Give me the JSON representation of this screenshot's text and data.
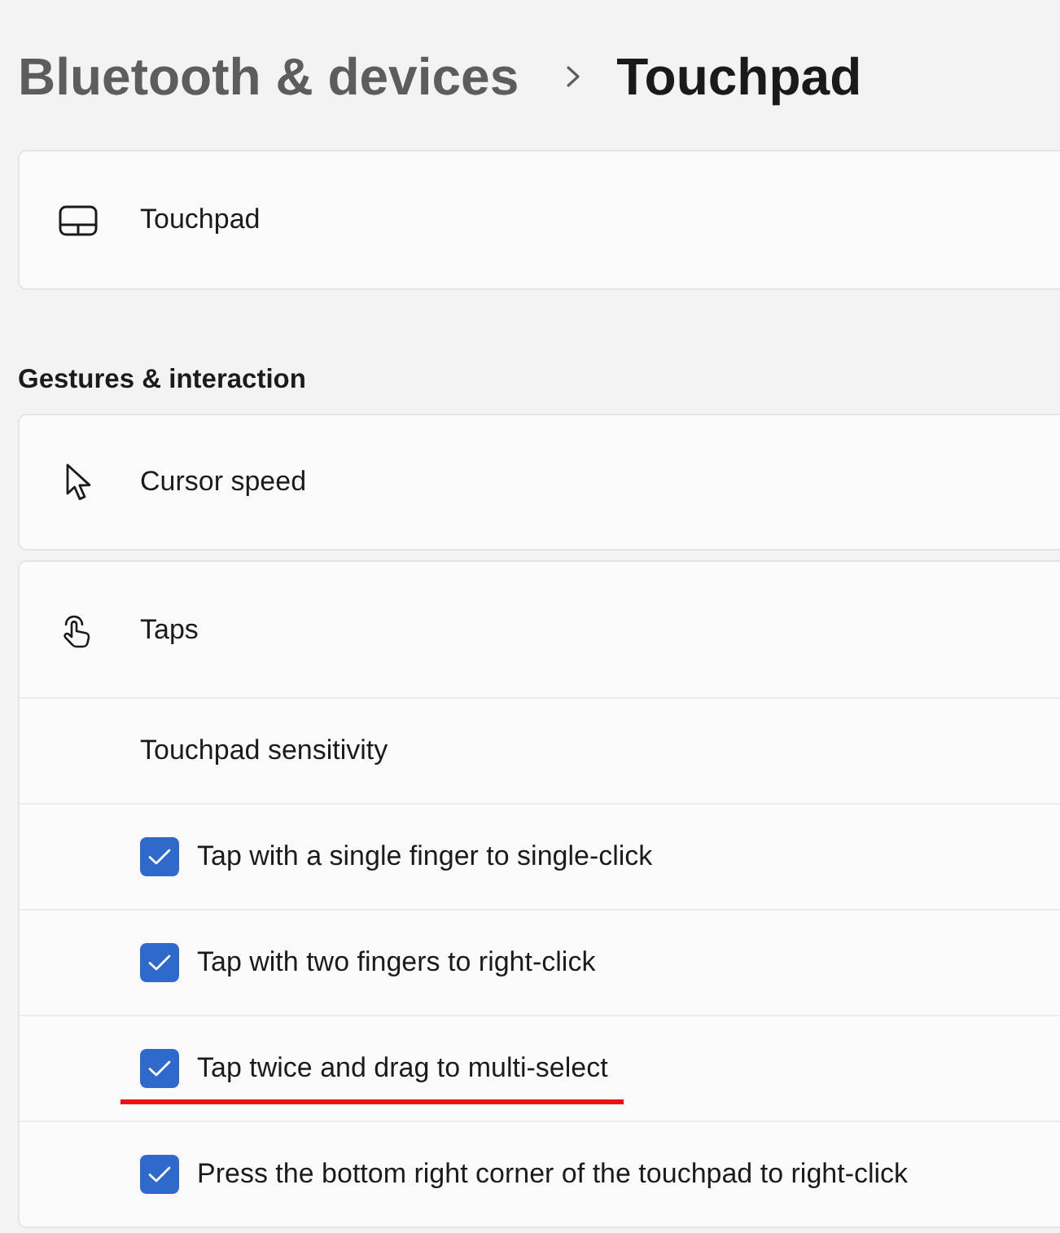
{
  "breadcrumb": {
    "parent": "Bluetooth & devices",
    "current": "Touchpad"
  },
  "device": {
    "label": "Touchpad"
  },
  "gestures": {
    "heading": "Gestures & interaction",
    "cursor_speed": {
      "label": "Cursor speed"
    },
    "taps": {
      "label": "Taps",
      "sensitivity": {
        "label": "Touchpad sensitivity"
      },
      "options": [
        {
          "label": "Tap with a single finger to single-click",
          "checked": true,
          "underlined": false
        },
        {
          "label": "Tap with two fingers to right-click",
          "checked": true,
          "underlined": false
        },
        {
          "label": "Tap twice and drag to multi-select",
          "checked": true,
          "underlined": true
        },
        {
          "label": "Press the bottom right corner of the touchpad to right-click",
          "checked": true,
          "underlined": false
        }
      ]
    }
  }
}
